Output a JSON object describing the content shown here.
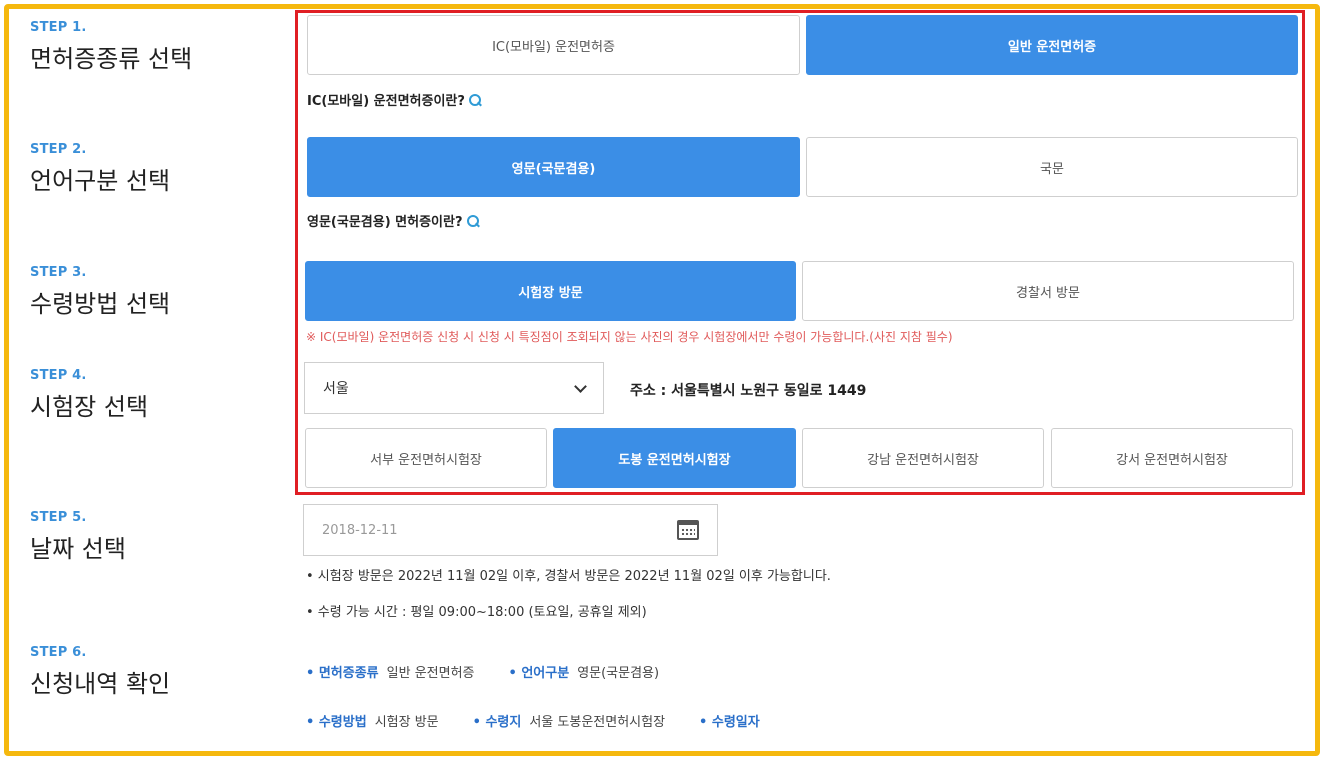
{
  "steps": [
    {
      "num": "STEP 1.",
      "title": "면허증종류 선택"
    },
    {
      "num": "STEP 2.",
      "title": "언어구분 선택"
    },
    {
      "num": "STEP 3.",
      "title": "수령방법 선택"
    },
    {
      "num": "STEP 4.",
      "title": "시험장 선택"
    },
    {
      "num": "STEP 5.",
      "title": "날짜 선택"
    },
    {
      "num": "STEP 6.",
      "title": "신청내역 확인"
    }
  ],
  "license_type": {
    "options": [
      "IC(모바일) 운전면허증",
      "일반 운전면허증"
    ],
    "selected": "일반 운전면허증",
    "info_link": "IC(모바일) 운전면허증이란?"
  },
  "language": {
    "options": [
      "영문(국문겸용)",
      "국문"
    ],
    "selected": "영문(국문겸용)",
    "info_link": "영문(국문겸용) 면허증이란?"
  },
  "receive_method": {
    "options": [
      "시험장 방문",
      "경찰서 방문"
    ],
    "selected": "시험장 방문",
    "warning": "※ IC(모바일) 운전면허증 신청 시 신청 시 특징점이 조회되지 않는 사진의 경우 시험장에서만 수령이 가능합니다.(사진 지참 필수)"
  },
  "test_center": {
    "region": "서울",
    "address": "주소 : 서울특별시 노원구 동일로 1449",
    "options": [
      "서부 운전면허시험장",
      "도봉 운전면허시험장",
      "강남 운전면허시험장",
      "강서 운전면허시험장"
    ],
    "selected": "도봉 운전면허시험장"
  },
  "date": {
    "value": "2018-12-11",
    "notes": [
      "• 시험장 방문은 2022년 11월 02일 이후, 경찰서 방문은 2022년 11월 02일 이후 가능합니다.",
      "• 수령 가능 시간 : 평일 09:00~18:00 (토요일, 공휴일 제외)"
    ]
  },
  "summary": {
    "row1": [
      {
        "key": "• 면허증종류",
        "value": "일반 운전면허증"
      },
      {
        "key": "• 언어구분",
        "value": "영문(국문겸용)"
      }
    ],
    "row2": [
      {
        "key": "• 수령방법",
        "value": "시험장 방문"
      },
      {
        "key": "• 수령지",
        "value": "서울 도봉운전면허시험장"
      },
      {
        "key": "• 수령일자",
        "value": ""
      }
    ]
  },
  "colors": {
    "accent": "#3b8ee6",
    "frame": "#f5b80e",
    "highlight": "#e01e24",
    "step_label": "#3a8fd8",
    "warning": "#e05a5a"
  }
}
